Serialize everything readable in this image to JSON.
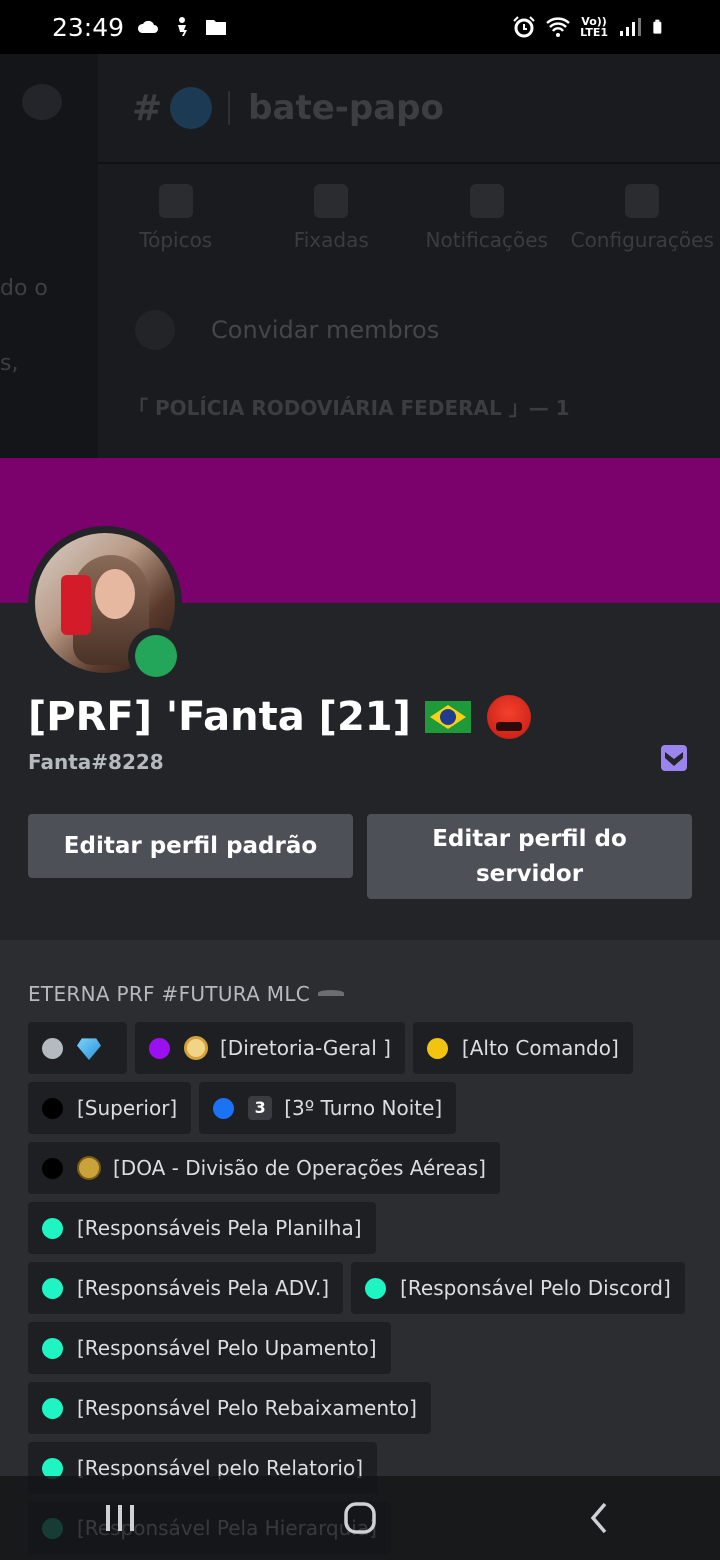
{
  "status_bar": {
    "time": "23:49",
    "network_label_top": "Vo))",
    "network_label_bottom": "LTE1"
  },
  "background_screen": {
    "channel_name": "bate-papo",
    "actions": [
      {
        "label": "Tópicos",
        "icon": "threads-icon"
      },
      {
        "label": "Fixadas",
        "icon": "pin-icon"
      },
      {
        "label": "Notificações",
        "icon": "bell-icon"
      },
      {
        "label": "Configurações",
        "icon": "gear-icon"
      }
    ],
    "invite_label": "Convidar membros",
    "section_header": "「 POLÍCIA RODOVIÁRIA FEDERAL 」— 1",
    "left_fragment_1": "do o",
    "left_fragment_2": "s,"
  },
  "profile": {
    "banner_color": "#7b016d",
    "display_name": "[PRF] 'Fanta [21]",
    "username": "Fanta#8228",
    "status": "online",
    "status_color": "#23a55a",
    "badge_icon": "nitro-chevron-icon",
    "buttons": {
      "edit_default": "Editar perfil padrão",
      "edit_server": "Editar perfil do servidor"
    }
  },
  "roles": {
    "title": "ETERNA PRF #FUTURA MLC",
    "rows": [
      [
        {
          "color": "#b5bac1",
          "emoji": "gem",
          "label": ""
        },
        {
          "color": "#9b10f0",
          "emoji": "laurel",
          "label": "[Diretoria-Geral ]"
        },
        {
          "color": "#f1c40f",
          "emoji": "",
          "label": "[Alto Comando]"
        }
      ],
      [
        {
          "color": "#000000",
          "emoji": "",
          "label": "[Superior]"
        },
        {
          "color": "#1a73f5",
          "emoji": "three",
          "label": "[3º Turno Noite]"
        }
      ],
      [
        {
          "color": "#000000",
          "emoji": "doa",
          "label": "[DOA - Divisão de Operações Aéreas]"
        }
      ],
      [
        {
          "color": "#1ef5c2",
          "emoji": "",
          "label": "[Responsáveis Pela Planilha]"
        }
      ],
      [
        {
          "color": "#1ef5c2",
          "emoji": "",
          "label": "[Responsáveis Pela ADV.]"
        },
        {
          "color": "#1ef5c2",
          "emoji": "",
          "label": "[Responsável Pelo Discord]"
        }
      ],
      [
        {
          "color": "#1ef5c2",
          "emoji": "",
          "label": "[Responsável Pelo Upamento]"
        }
      ],
      [
        {
          "color": "#1ef5c2",
          "emoji": "",
          "label": "[Responsável Pelo Rebaixamento]"
        }
      ],
      [
        {
          "color": "#1ef5c2",
          "emoji": "",
          "label": "[Responsável pelo Relatorio]"
        }
      ],
      [
        {
          "color": "#1ef5c2",
          "emoji": "",
          "label": "[Responsável Pela Hierarquia]"
        }
      ]
    ]
  },
  "navbar": {
    "buttons": [
      "recents-icon",
      "home-icon",
      "back-icon"
    ]
  }
}
